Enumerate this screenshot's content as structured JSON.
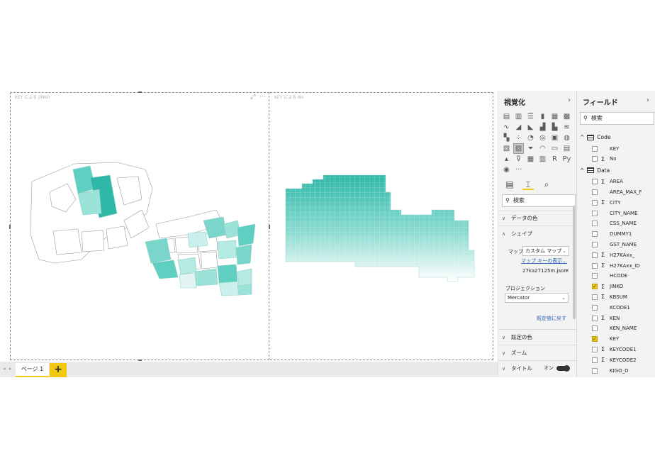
{
  "visuals": {
    "left_title": "KEY による JINKO",
    "right_title": "KEY による No",
    "tool_focus": "⤢",
    "tool_more": "···"
  },
  "page_tabs": {
    "nav_prev": "◂",
    "nav_next": "▸",
    "active_label": "ページ 1",
    "add_label": "+"
  },
  "viz_pane": {
    "title": "視覚化",
    "collapse": "›",
    "more": "···",
    "search_icon": "⚲",
    "search_placeholder": "検索",
    "sections": {
      "data_colors": "データの色",
      "shape": "シェイプ",
      "default_colors": "既定の色",
      "zoom": "ズーム",
      "title": "タイトル"
    },
    "map_label": "マップ",
    "map_value": "カスタム マップ",
    "map_keys_link": "マップ キーの表示...",
    "file_name": "27ka27125m.json",
    "file_remove": "✕",
    "projection_label": "プロジェクション",
    "projection_value": "Mercator",
    "reset_link": "既定値に戻す",
    "title_toggle": "オン"
  },
  "fields_pane": {
    "title": "フィールド",
    "collapse": "›",
    "search_placeholder": "検索",
    "tables": [
      {
        "name": "Code",
        "fields": [
          {
            "name": "KEY",
            "sigma": false,
            "checked": false
          },
          {
            "name": "No",
            "sigma": true,
            "checked": false
          }
        ]
      },
      {
        "name": "Data",
        "fields": [
          {
            "name": "AREA",
            "sigma": true,
            "checked": false
          },
          {
            "name": "AREA_MAX_F",
            "sigma": false,
            "checked": false
          },
          {
            "name": "CITY",
            "sigma": true,
            "checked": false
          },
          {
            "name": "CITY_NAME",
            "sigma": false,
            "checked": false
          },
          {
            "name": "CSS_NAME",
            "sigma": false,
            "checked": false
          },
          {
            "name": "DUMMY1",
            "sigma": false,
            "checked": false
          },
          {
            "name": "GST_NAME",
            "sigma": false,
            "checked": false
          },
          {
            "name": "H27KAxx_",
            "sigma": true,
            "checked": false
          },
          {
            "name": "H27KAxx_ID",
            "sigma": true,
            "checked": false
          },
          {
            "name": "HCODE",
            "sigma": false,
            "checked": false
          },
          {
            "name": "JINKO",
            "sigma": true,
            "checked": true
          },
          {
            "name": "KBSUM",
            "sigma": true,
            "checked": false
          },
          {
            "name": "KCODE1",
            "sigma": false,
            "checked": false
          },
          {
            "name": "KEN",
            "sigma": true,
            "checked": false
          },
          {
            "name": "KEN_NAME",
            "sigma": false,
            "checked": false
          },
          {
            "name": "KEY",
            "sigma": false,
            "checked": true
          },
          {
            "name": "KEYCODE1",
            "sigma": true,
            "checked": false
          },
          {
            "name": "KEYCODE2",
            "sigma": true,
            "checked": false
          },
          {
            "name": "KIGO_D",
            "sigma": false,
            "checked": false
          }
        ]
      }
    ],
    "sigma_symbol": "Σ",
    "check_symbol": "✓",
    "expand_symbol": "^"
  },
  "colors": {
    "accent": "#f2c811",
    "teal": "#3bbfae",
    "teal_light": "#e3f5f3"
  }
}
